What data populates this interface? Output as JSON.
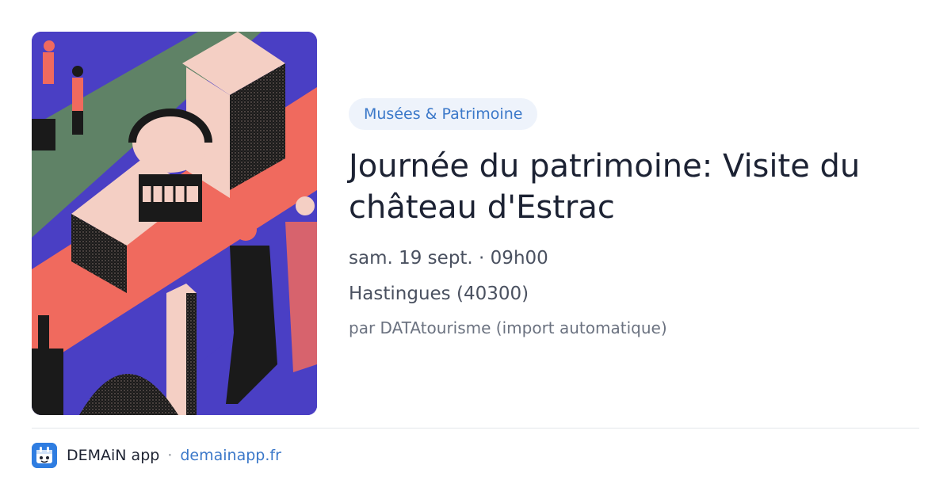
{
  "event": {
    "category": "Musées & Patrimoine",
    "title": "Journée du patrimoine: Visite du château d'Estrac",
    "datetime": "sam. 19 sept. · 09h00",
    "location": "Hastingues (40300)",
    "source": "par DATAtourisme (import automatique)"
  },
  "image": {
    "alt": "Illustration: visitors exploring a geometric castle"
  },
  "footer": {
    "app_name": "DEMAiN app",
    "separator": "·",
    "domain": "demainapp.fr",
    "icon": "demain-app-icon"
  },
  "colors": {
    "chip_bg": "#eef3fb",
    "accent": "#3b78c9",
    "illustration_blue": "#4a3fc4",
    "illustration_salmon": "#f06a5e",
    "illustration_green": "#5f8266",
    "illustration_pink": "#f4cfc4"
  }
}
